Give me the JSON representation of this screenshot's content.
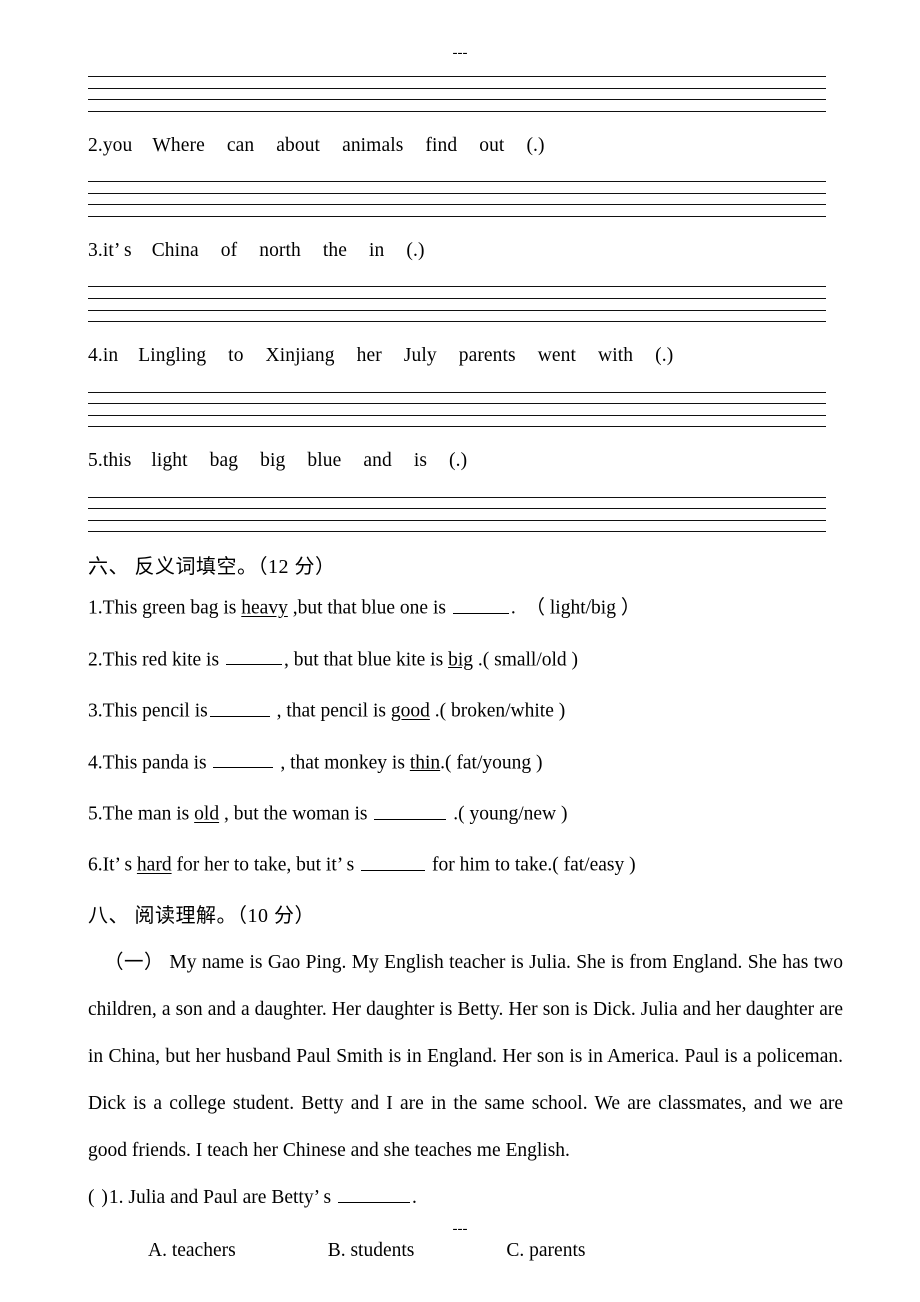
{
  "page": {
    "header_mark": "---",
    "footer_mark": "---"
  },
  "scrambled_section": {
    "items": [
      {
        "number": "2.",
        "words": [
          "you",
          "Where",
          "can",
          "about",
          "animals",
          "find",
          "out",
          "(.)"
        ]
      },
      {
        "number": "3.",
        "words": [
          "it’ s",
          "China",
          "of",
          "north",
          "the",
          "in",
          "(.)"
        ]
      },
      {
        "number": "4.",
        "words": [
          "in",
          "Lingling",
          "to",
          "Xinjiang",
          "her",
          "July",
          "parents",
          "went",
          "with",
          "(.)"
        ]
      },
      {
        "number": "5.",
        "words": [
          "this",
          "light",
          "bag",
          "big",
          "blue",
          "and",
          "is",
          "(.)"
        ]
      }
    ]
  },
  "section_six": {
    "heading": "六、 反义词填空。（12 分）",
    "items": [
      {
        "number": "1.",
        "pre": "This green bag is ",
        "underlined": "heavy",
        "mid": " ,but that blue one is ",
        "blank": "b1",
        "post": ".",
        "options": "（ light/big ）"
      },
      {
        "number": "2.",
        "pre": "This red kite is ",
        "underlined": "",
        "mid": "",
        "blank": "b1",
        "post": ", but that blue kite is ",
        "underlined2": "big",
        "post2": " .",
        "options": "( small/old )"
      },
      {
        "number": "3.",
        "pre": "This pencil is",
        "blank": "b2",
        "post": " , that pencil is ",
        "underlined2": "good",
        "post2": " .",
        "options": "( broken/white )"
      },
      {
        "number": "4.",
        "pre": "This panda is ",
        "blank": "b2",
        "post": " , that monkey is ",
        "underlined2": "thin",
        "post2": ".",
        "options": "( fat/young )"
      },
      {
        "number": "5.",
        "pre": "The man is ",
        "underlined": "old",
        "mid": " , but the woman is ",
        "blank": "b3",
        "post": " .",
        "options": "( young/new )"
      },
      {
        "number": "6.",
        "pre": "It’ s ",
        "underlined": "hard",
        "mid": " for her to take, but it’ s ",
        "blank": "b4",
        "post": " for him to take.",
        "options": "( fat/easy )"
      }
    ]
  },
  "section_eight": {
    "heading": "八、 阅读理解。（10 分）",
    "passage_marker": "（一）",
    "passage": "My name is Gao Ping. My English teacher is Julia. She is from England. She has two children, a son and a daughter. Her daughter is Betty. Her son is Dick. Julia and her daughter are in China, but her husband Paul Smith is in England. Her son is in America. Paul is a policeman. Dick is a college student. Betty and I are in the same school. We are classmates, and we are good friends. I teach her Chinese and she teaches me English.",
    "question": {
      "bracket": "(  )",
      "number": "1.",
      "text": "Julia and Paul are Betty’ s",
      "period": ".",
      "choices": [
        "A. teachers",
        "B. students",
        "C. parents"
      ]
    }
  }
}
